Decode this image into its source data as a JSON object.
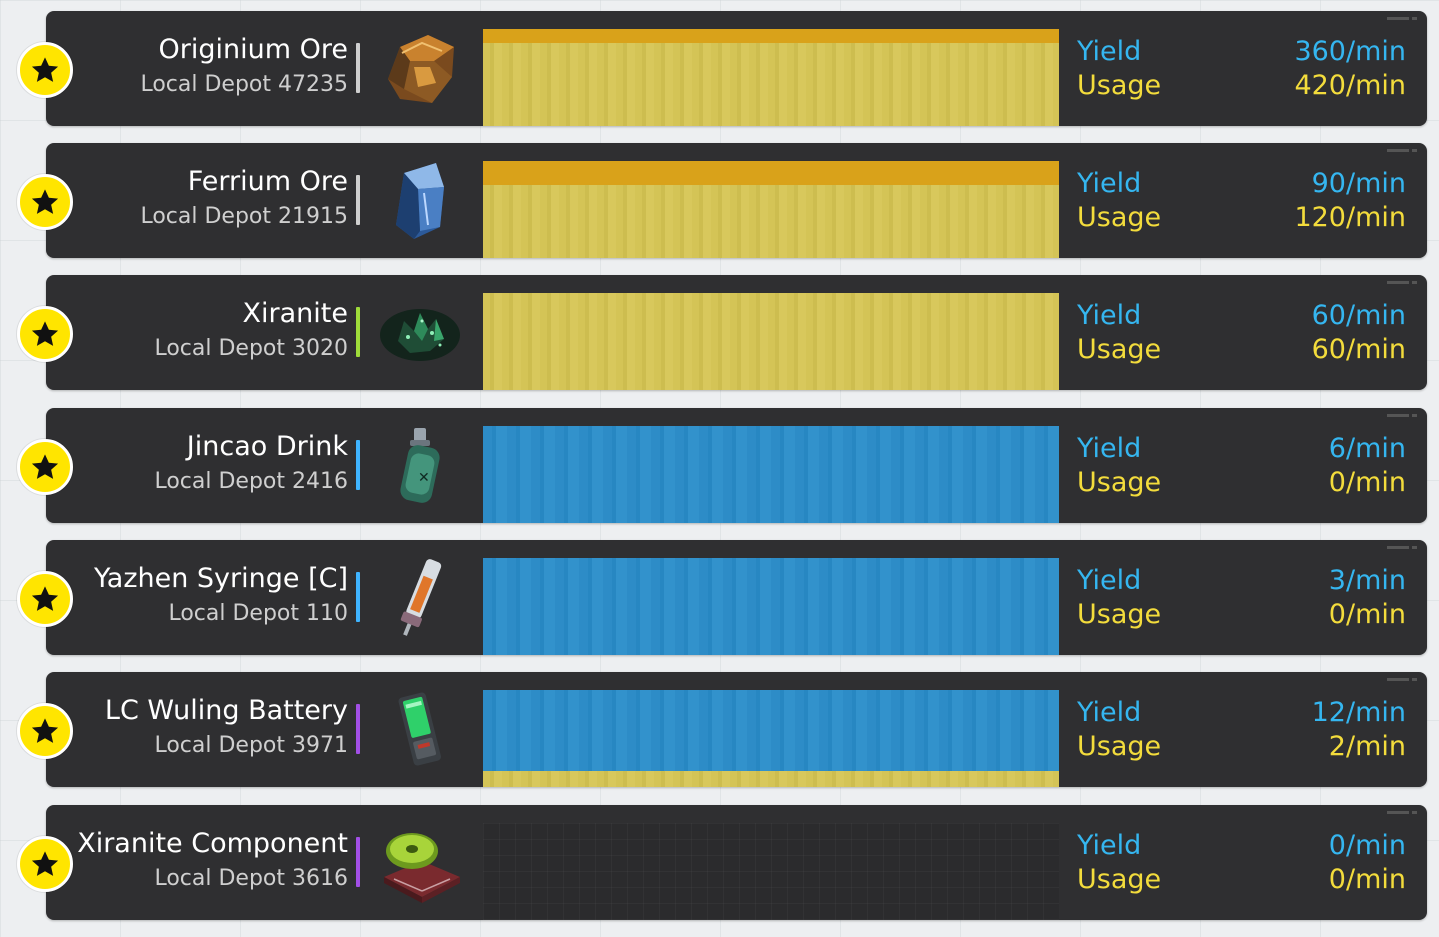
{
  "labels": {
    "yield": "Yield",
    "usage": "Usage"
  },
  "colors": {
    "star_button": "#ffe500",
    "yield_text": "#35b6f0",
    "usage_text": "#f3dc3c",
    "usage_bar": "#d4c456",
    "yield_bar": "#2d8cc7",
    "usage_overflow": "#d9a21a"
  },
  "items": [
    {
      "name": "Originium Ore",
      "depot": "Local Depot 47235",
      "yield": "360/min",
      "usage": "420/min",
      "icon": "originium-ore-icon",
      "accent": "#cfcfcf",
      "yield_fraction": 0.857,
      "usage_fraction": 1.0
    },
    {
      "name": "Ferrium Ore",
      "depot": "Local Depot 21915",
      "yield": "90/min",
      "usage": "120/min",
      "icon": "ferrium-ore-icon",
      "accent": "#cfcfcf",
      "yield_fraction": 0.75,
      "usage_fraction": 1.0
    },
    {
      "name": "Xiranite",
      "depot": "Local Depot 3020",
      "yield": "60/min",
      "usage": "60/min",
      "icon": "xiranite-icon",
      "accent": "#9fdc3a",
      "yield_fraction": 1.0,
      "usage_fraction": 1.0
    },
    {
      "name": "Jincao Drink",
      "depot": "Local Depot 2416",
      "yield": "6/min",
      "usage": "0/min",
      "icon": "jincao-drink-icon",
      "accent": "#3fb4ff",
      "yield_fraction": 1.0,
      "usage_fraction": 0.0
    },
    {
      "name": "Yazhen Syringe [C]",
      "depot": "Local Depot 110",
      "yield": "3/min",
      "usage": "0/min",
      "icon": "yazhen-syringe-icon",
      "accent": "#3fb4ff",
      "yield_fraction": 1.0,
      "usage_fraction": 0.0
    },
    {
      "name": "LC Wuling Battery",
      "depot": "Local Depot 3971",
      "yield": "12/min",
      "usage": "2/min",
      "icon": "lc-wuling-battery-icon",
      "accent": "#a24fe6",
      "yield_fraction": 1.0,
      "usage_fraction": 0.167
    },
    {
      "name": "Xiranite Component",
      "depot": "Local Depot 3616",
      "yield": "0/min",
      "usage": "0/min",
      "icon": "xiranite-component-icon",
      "accent": "#a24fe6",
      "yield_fraction": 0.0,
      "usage_fraction": 0.0
    }
  ]
}
